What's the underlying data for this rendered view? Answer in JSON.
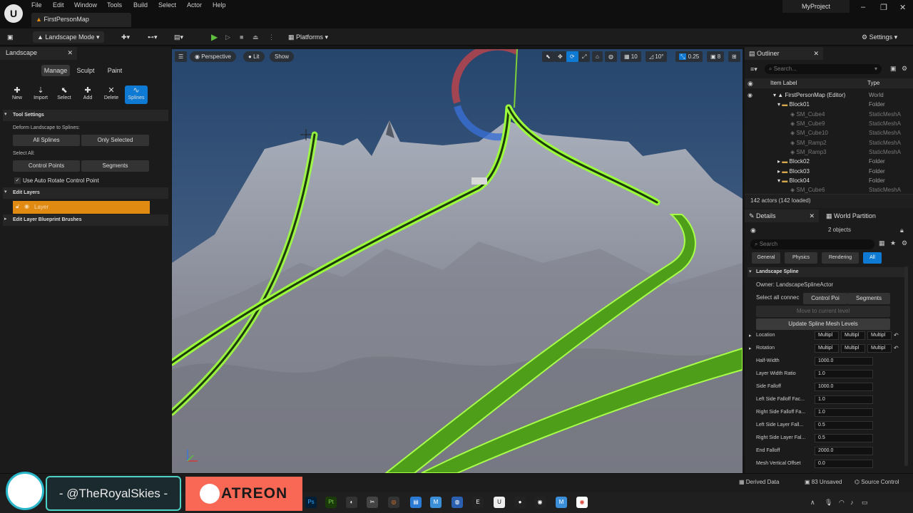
{
  "menu": [
    "File",
    "Edit",
    "Window",
    "Tools",
    "Build",
    "Select",
    "Actor",
    "Help"
  ],
  "map_tab": "FirstPersonMap",
  "project": "MyProject",
  "toolbar": {
    "mode": "Landscape Mode",
    "platforms": "Platforms",
    "settings": "Settings"
  },
  "landscape": {
    "tab": "Landscape",
    "modes": [
      "Manage",
      "Sculpt",
      "Paint"
    ],
    "tools": [
      "New",
      "Import",
      "Select",
      "Add",
      "Delete",
      "Splines"
    ],
    "tool_settings": "Tool Settings",
    "deform_label": "Deform Landscape to Splines:",
    "all_splines": "All Splines",
    "only_selected": "Only Selected",
    "select_all": "Select All:",
    "control_points": "Control Points",
    "segments": "Segments",
    "auto_rotate": "Use Auto Rotate Control Point",
    "edit_layers": "Edit Layers",
    "layer": "Layer",
    "edit_bp_brushes": "Edit Layer Blueprint Brushes"
  },
  "viewport": {
    "perspective": "Perspective",
    "lit": "Lit",
    "show": "Show",
    "grid": "10",
    "angle": "10°",
    "scale": "0.25",
    "cam": "8"
  },
  "outliner": {
    "tab": "Outliner",
    "search": "Search...",
    "col_label": "Item Label",
    "col_type": "Type",
    "rows": [
      {
        "name": "FirstPersonMap (Editor)",
        "type": "World"
      },
      {
        "name": "Block01",
        "type": "Folder"
      },
      {
        "name": "SM_Cube4",
        "type": "StaticMeshA"
      },
      {
        "name": "SM_Cube9",
        "type": "StaticMeshA"
      },
      {
        "name": "SM_Cube10",
        "type": "StaticMeshA"
      },
      {
        "name": "SM_Ramp2",
        "type": "StaticMeshA"
      },
      {
        "name": "SM_Ramp3",
        "type": "StaticMeshA"
      },
      {
        "name": "Block02",
        "type": "Folder"
      },
      {
        "name": "Block03",
        "type": "Folder"
      },
      {
        "name": "Block04",
        "type": "Folder"
      },
      {
        "name": "SM_Cube6",
        "type": "StaticMeshA"
      }
    ],
    "count": "142 actors (142 loaded)"
  },
  "details": {
    "tab": "Details",
    "tab2": "World Partition",
    "objects": "2 objects",
    "search": "Search",
    "filters": [
      "General",
      "Physics",
      "Rendering",
      "All"
    ],
    "section": "Landscape Spline",
    "owner": "Owner: LandscapeSplineActor",
    "select_all": "Select all connec",
    "control_poi": "Control Poi",
    "segments": "Segments",
    "move": "Move to current level",
    "update": "Update Spline Mesh Levels",
    "location": "Location",
    "rotation": "Rotation",
    "multi": "Multipl",
    "props": [
      {
        "label": "Half-Width",
        "value": "1000.0"
      },
      {
        "label": "Layer Width Ratio",
        "value": "1.0"
      },
      {
        "label": "Side Falloff",
        "value": "1000.0"
      },
      {
        "label": "Left Side Falloff Fac...",
        "value": "1.0"
      },
      {
        "label": "Right Side Falloff Fa...",
        "value": "1.0"
      },
      {
        "label": "Left Side Layer Fall...",
        "value": "0.5"
      },
      {
        "label": "Right Side Layer Fal...",
        "value": "0.5"
      },
      {
        "label": "End Falloff",
        "value": "2000.0"
      },
      {
        "label": "Mesh Vertical Offset",
        "value": "0.0"
      }
    ]
  },
  "status": {
    "derived": "Derived Data",
    "unsaved": "83 Unsaved",
    "source": "Source Control"
  },
  "overlay": {
    "handle": "- @TheRoyalSkies -",
    "patreon": "ATREON"
  }
}
